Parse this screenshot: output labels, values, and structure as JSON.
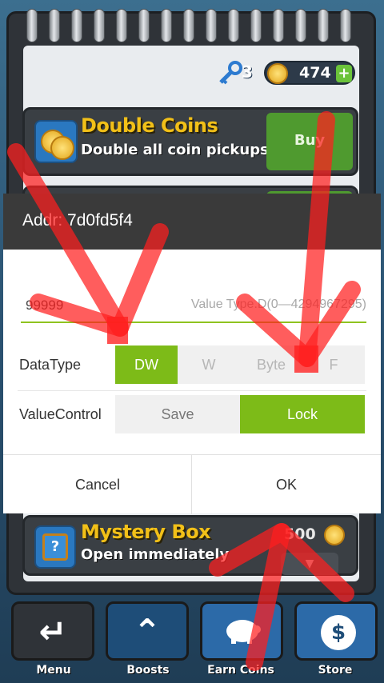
{
  "game": {
    "keys": "3",
    "coins": "474",
    "plus": "+",
    "cards": [
      {
        "title": "Double Coins",
        "subtitle": "Double all coin pickups",
        "action": "Buy"
      },
      {
        "title": "Mystery Box",
        "subtitle": "Open immediately",
        "price": "500"
      }
    ],
    "nav": [
      {
        "label": "Menu",
        "icon": "back-arrow-icon"
      },
      {
        "label": "Boosts",
        "icon": "double-chevron-up-icon"
      },
      {
        "label": "Earn Coins",
        "icon": "piggy-bank-icon"
      },
      {
        "label": "Store",
        "icon": "dollar-coin-icon"
      }
    ]
  },
  "dialog": {
    "title_prefix": "Addr: ",
    "address": "7d0fd5f4",
    "value": "99999",
    "value_hint": "Value Type.D(0—4294967295)",
    "datatype_label": "DataType",
    "datatype_options": [
      "DW",
      "W",
      "Byte",
      "F"
    ],
    "datatype_selected": "DW",
    "valuecontrol_label": "ValueControl",
    "valuecontrol_options": [
      "Save",
      "Lock"
    ],
    "valuecontrol_selected": "Lock",
    "cancel": "Cancel",
    "ok": "OK"
  },
  "colors": {
    "accent_green": "#7dbb18",
    "header_dark": "#3a3a3a",
    "annotation_red": "#ff1f1f"
  }
}
